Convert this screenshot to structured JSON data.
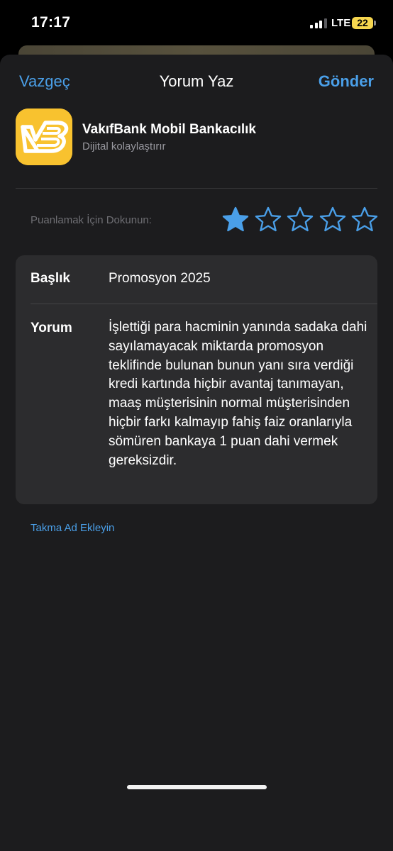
{
  "status_bar": {
    "time": "17:17",
    "network": "LTE",
    "battery_level": "22",
    "signal_bars_active": 3,
    "signal_bars_total": 4
  },
  "nav": {
    "cancel_label": "Vazgeç",
    "title": "Yorum Yaz",
    "send_label": "Gönder"
  },
  "app": {
    "name": "VakıfBank Mobil Bankacılık",
    "subtitle": "Dijital kolaylaştırır",
    "icon": "vakifbank-logo-icon",
    "icon_bg_color": "#f8c22f"
  },
  "rating": {
    "prompt": "Puanlamak İçin Dokunun:",
    "value": 1,
    "max": 5,
    "star_color": "#4a9fe8"
  },
  "form": {
    "title_label": "Başlık",
    "title_value": "Promosyon 2025",
    "review_label": "Yorum",
    "review_value": "İşlettiği para hacminin yanında sadaka dahi sayılamayacak miktarda promosyon teklifinde bulunan bunun yanı sıra verdiği kredi kartında hiçbir avantaj tanımayan, maaş müşterisinin normal müşterisinden hiçbir farkı kalmayıp fahiş faiz oranlarıyla sömüren bankaya 1 puan dahi vermek gereksizdir."
  },
  "nickname_link": "Takma Ad Ekleyin",
  "colors": {
    "accent": "#4a9fe8",
    "sheet_bg": "#1c1c1e",
    "card_bg": "#2c2c2e"
  }
}
